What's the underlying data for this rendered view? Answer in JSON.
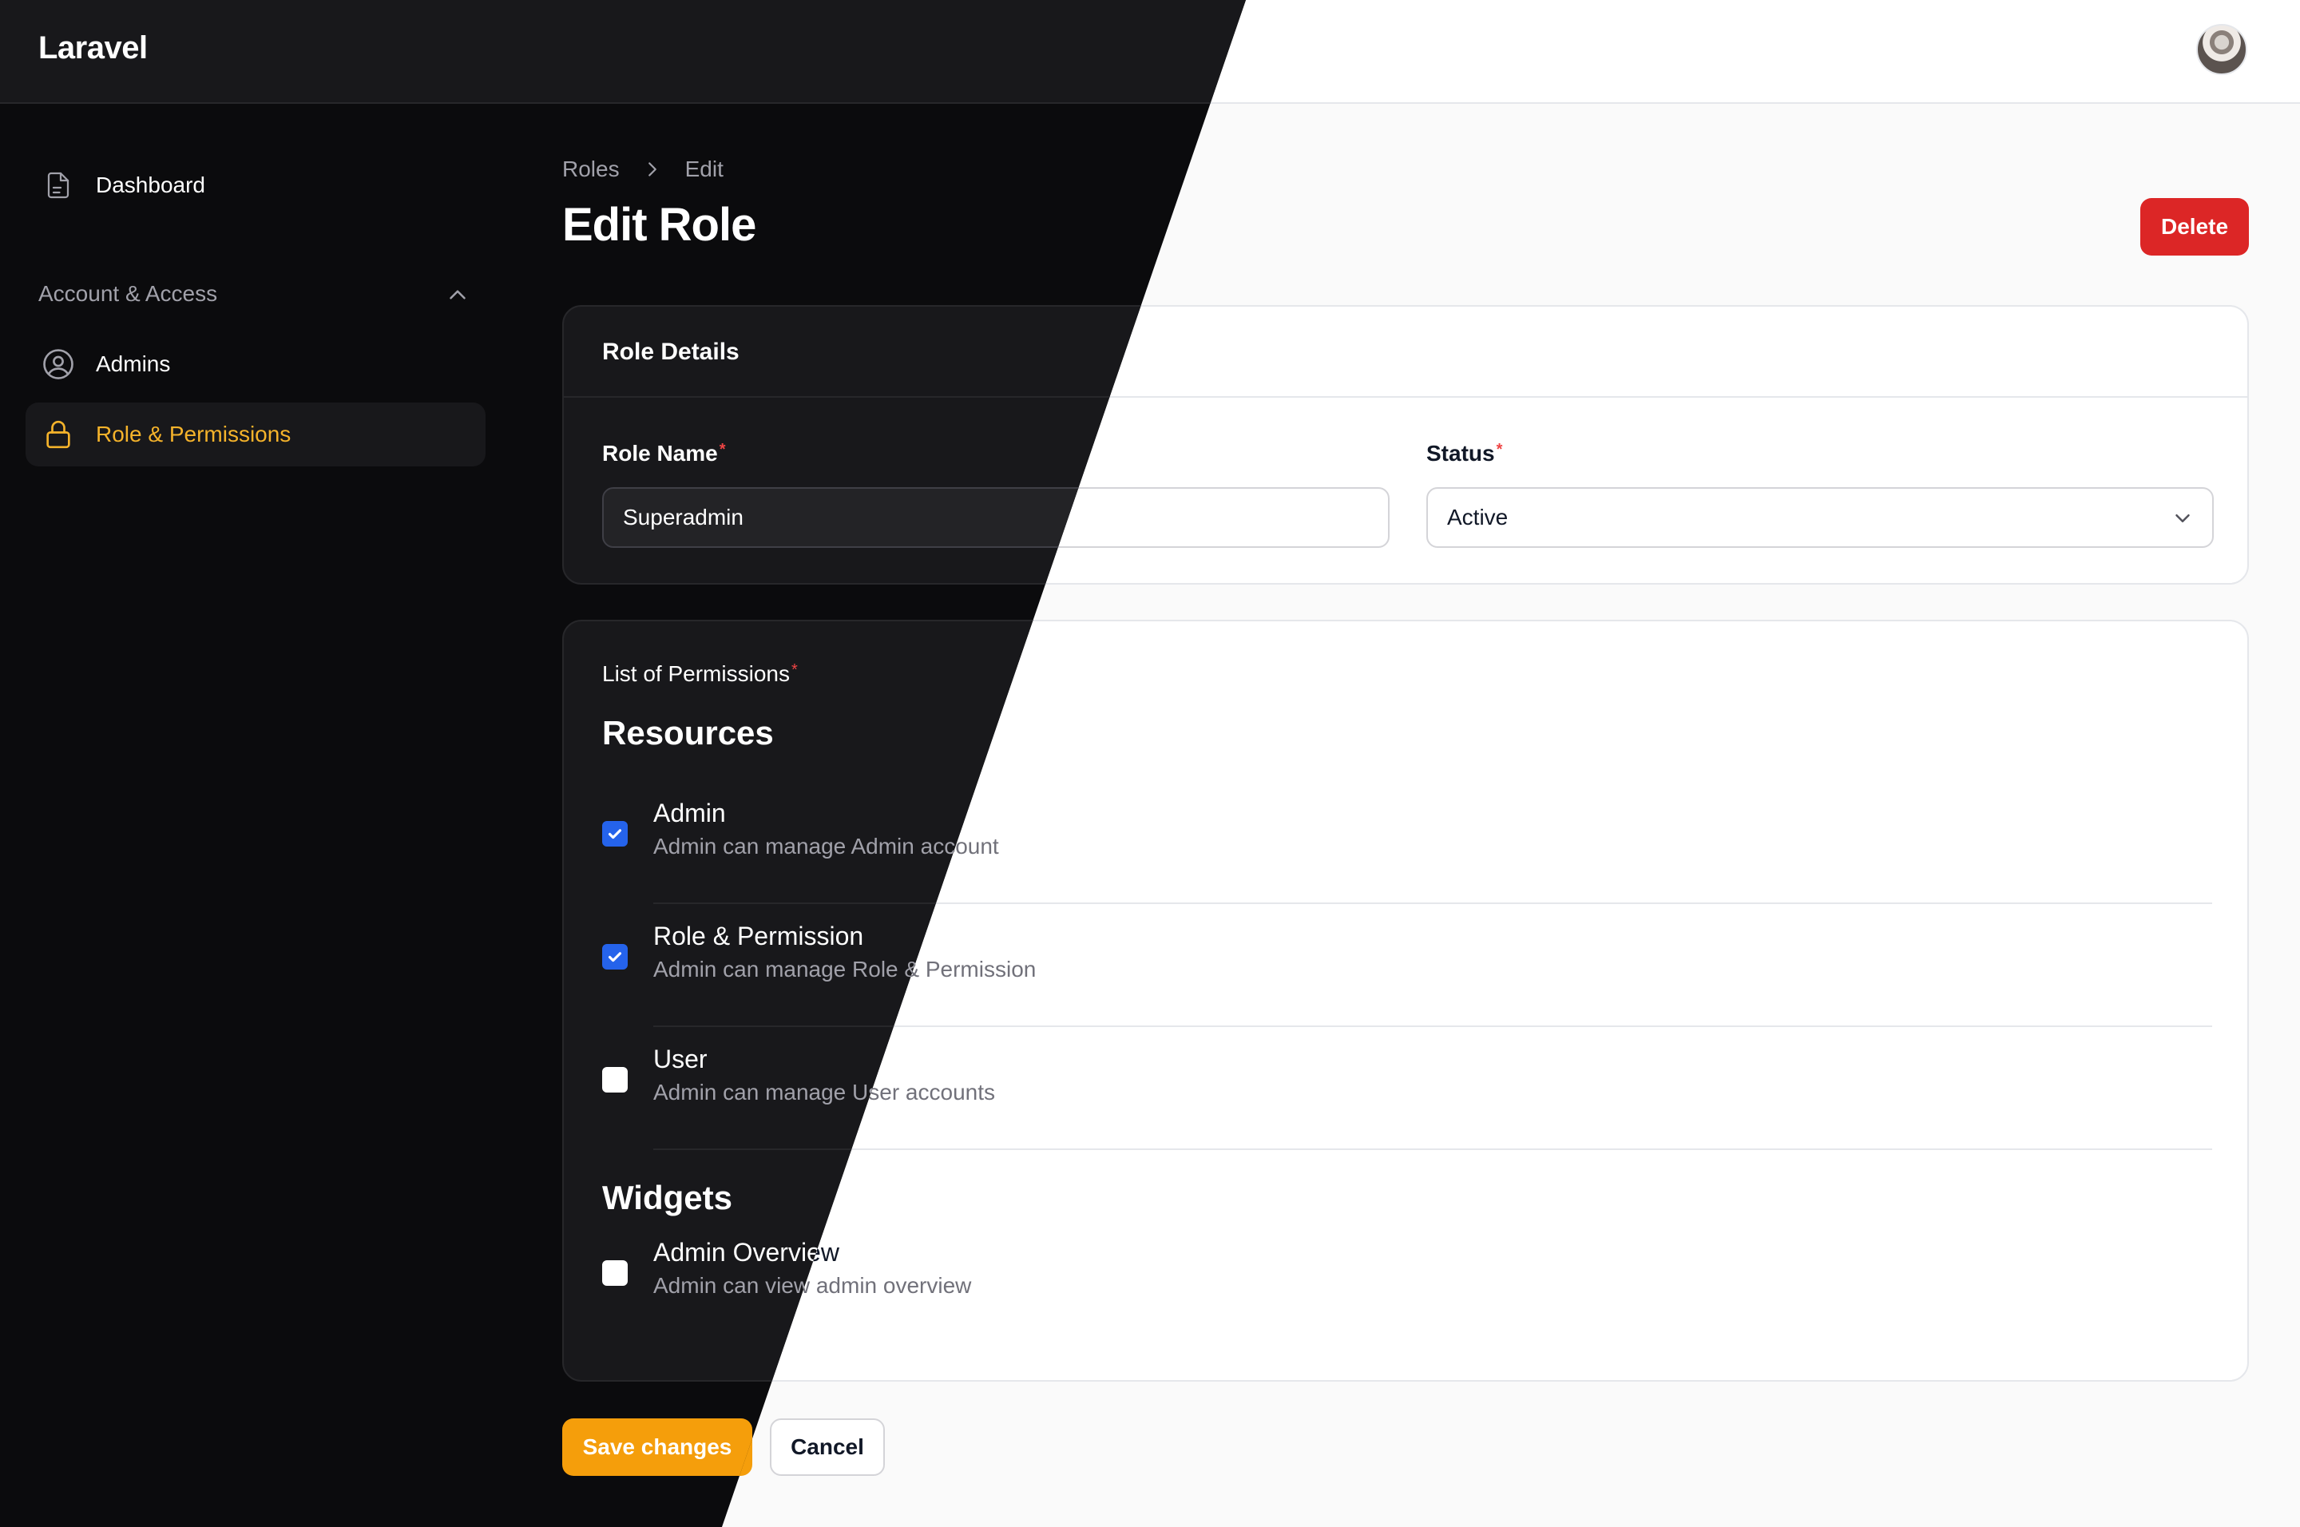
{
  "app": {
    "brand": "Laravel"
  },
  "sidebar": {
    "dashboard_label": "Dashboard",
    "group_label": "Account & Access",
    "items": [
      {
        "label": "Admins",
        "icon": "user-circle-icon"
      },
      {
        "label": "Role & Permissions",
        "icon": "lock-icon",
        "active": true
      }
    ]
  },
  "breadcrumb": {
    "items": [
      "Roles",
      "Edit"
    ]
  },
  "page": {
    "title": "Edit Role",
    "delete_label": "Delete"
  },
  "role_details": {
    "title": "Role Details",
    "role_name_label": "Role Name",
    "role_name_value": "Superadmin",
    "status_label": "Status",
    "status_value": "Active",
    "required_mark": "*"
  },
  "permissions": {
    "label": "List of Permissions",
    "resources_title": "Resources",
    "resources": [
      {
        "title": "Admin",
        "description": "Admin can manage Admin account",
        "checked": true
      },
      {
        "title": "Role & Permission",
        "description": "Admin can manage Role & Permission",
        "checked": true
      },
      {
        "title": "User",
        "description": "Admin can manage User accounts",
        "checked": false
      }
    ],
    "widgets_title": "Widgets",
    "widgets": [
      {
        "title": "Admin Overview",
        "description": "Admin can view admin overview",
        "checked": false
      }
    ]
  },
  "actions": {
    "save_label": "Save changes",
    "cancel_label": "Cancel"
  },
  "colors": {
    "accent": "#f59e0b",
    "danger": "#dc2626",
    "checkbox": "#2563eb",
    "active_nav": "#f5b32b"
  }
}
